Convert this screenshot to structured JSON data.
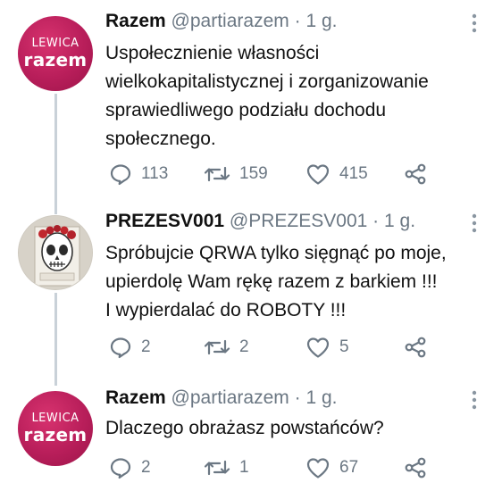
{
  "colors": {
    "brand": "#b81e5a",
    "muted_text": "#6b7783",
    "thread_line": "#c9d1d8"
  },
  "tweets": [
    {
      "avatar_type": "lewica-razem-logo",
      "avatar_logo": {
        "top": "LEWICA",
        "bottom": "razem"
      },
      "display_name": "Razem",
      "handle": "@partiarazem",
      "separator": "·",
      "time": "1 g.",
      "text_lines": [
        "Uspołecznienie własności",
        "wielkokapitalistycznej i zorganizowanie",
        "sprawiedliwego podziału dochodu",
        "społecznego."
      ],
      "replies": "113",
      "retweets": "159",
      "likes": "415",
      "icons": [
        "reply-icon",
        "retweet-icon",
        "like-icon",
        "share-icon",
        "more-icon"
      ]
    },
    {
      "avatar_type": "user-photo",
      "display_name": "PREZESV001",
      "handle": "@PREZESV001",
      "separator": "·",
      "time": "1 g.",
      "text_lines": [
        "Spróbujcie QRWA tylko sięgnąć po moje,",
        "upierdolę Wam rękę razem z barkiem !!!",
        "I wypierdalać do ROBOTY !!!"
      ],
      "replies": "2",
      "retweets": "2",
      "likes": "5",
      "icons": [
        "reply-icon",
        "retweet-icon",
        "like-icon",
        "share-icon",
        "more-icon"
      ]
    },
    {
      "avatar_type": "lewica-razem-logo",
      "avatar_logo": {
        "top": "LEWICA",
        "bottom": "razem"
      },
      "display_name": "Razem",
      "handle": "@partiarazem",
      "separator": "·",
      "time": "1 g.",
      "text_lines": [
        "Dlaczego obrażasz powstańców?"
      ],
      "replies": "2",
      "retweets": "1",
      "likes": "67",
      "icons": [
        "reply-icon",
        "retweet-icon",
        "like-icon",
        "share-icon",
        "more-icon"
      ]
    }
  ]
}
